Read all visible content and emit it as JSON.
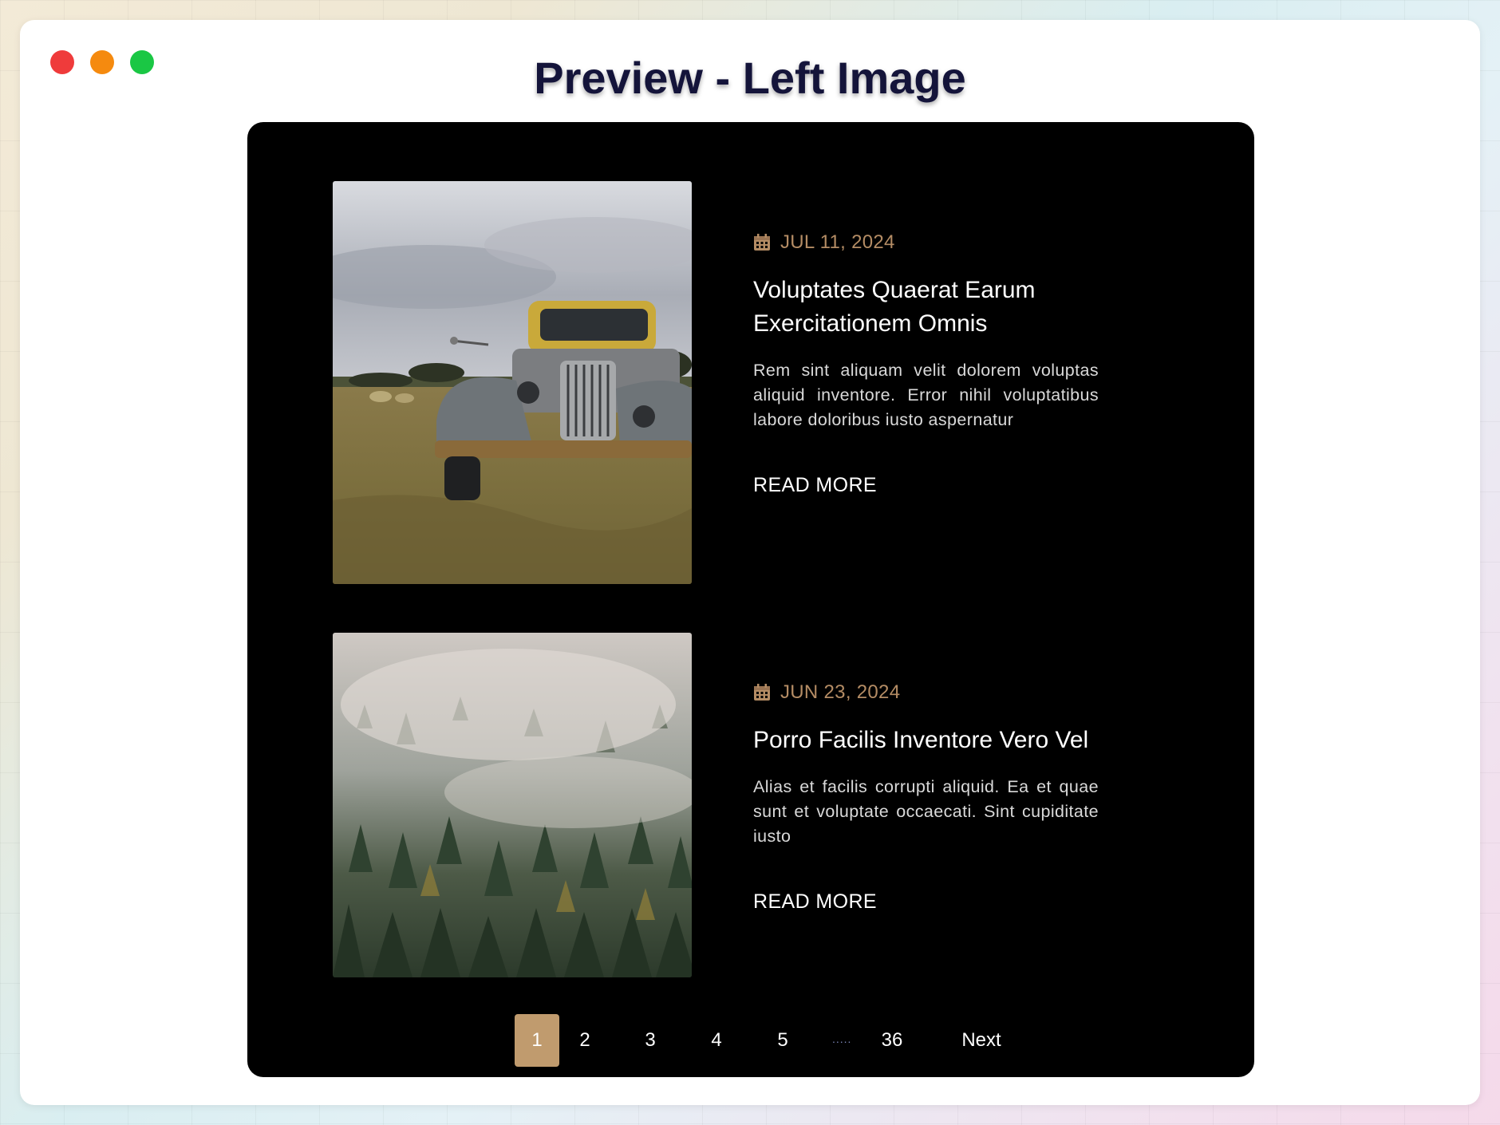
{
  "window": {
    "title": "Preview - Left Image",
    "traffic_lights": {
      "close": "#ef3b3b",
      "minimize": "#f58a0f",
      "maximize": "#1ac744"
    }
  },
  "posts": [
    {
      "date": "JUL 11, 2024",
      "title": "Voluptates Quaerat Earum Exercitationem Omnis",
      "excerpt": "Rem sint aliquam velit dolorem voluptas aliquid inventore. Error nihil voluptatibus labore doloribus iusto aspernatur",
      "read_more": "READ MORE",
      "image": "vintage-truck-field"
    },
    {
      "date": "JUN 23, 2024",
      "title": "Porro Facilis Inventore Vero Vel",
      "excerpt": "Alias et facilis corrupti aliquid. Ea et quae sunt et voluptate occaecati. Sint cupiditate iusto",
      "read_more": "READ MORE",
      "image": "misty-forest"
    }
  ],
  "pagination": {
    "pages": [
      "1",
      "2",
      "3",
      "4",
      "5"
    ],
    "ellipsis": ".....",
    "last": "36",
    "next": "Next",
    "active": "1"
  },
  "colors": {
    "accent": "#c09b6e",
    "date": "#b48c64",
    "card_bg": "#000000"
  }
}
